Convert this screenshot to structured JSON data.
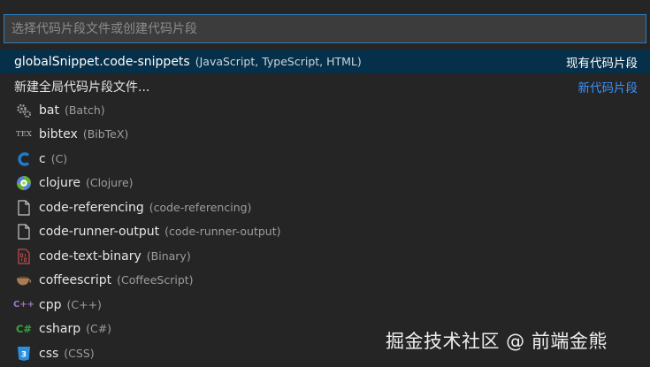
{
  "search": {
    "placeholder": "选择代码片段文件或创建代码片段"
  },
  "global_item": {
    "label": "globalSnippet.code-snippets",
    "description": "(JavaScript, TypeScript, HTML)",
    "group": "现有代码片段"
  },
  "new_item": {
    "label": "新建全局代码片段文件...",
    "group": "新代码片段"
  },
  "languages": [
    {
      "label": "bat",
      "description": "(Batch)",
      "icon": "gear-icon"
    },
    {
      "label": "bibtex",
      "description": "(BibTeX)",
      "icon": "tex-icon"
    },
    {
      "label": "c",
      "description": "(C)",
      "icon": "c-language-icon"
    },
    {
      "label": "clojure",
      "description": "(Clojure)",
      "icon": "clojure-icon"
    },
    {
      "label": "code-referencing",
      "description": "(code-referencing)",
      "icon": "file-icon"
    },
    {
      "label": "code-runner-output",
      "description": "(code-runner-output)",
      "icon": "file-icon"
    },
    {
      "label": "code-text-binary",
      "description": "(Binary)",
      "icon": "binary-file-icon"
    },
    {
      "label": "coffeescript",
      "description": "(CoffeeScript)",
      "icon": "coffee-icon"
    },
    {
      "label": "cpp",
      "description": "(C++)",
      "icon": "cpp-icon"
    },
    {
      "label": "csharp",
      "description": "(C#)",
      "icon": "csharp-icon"
    },
    {
      "label": "css",
      "description": "(CSS)",
      "icon": "css3-icon"
    }
  ],
  "icon_glyphs": {
    "tex": "TEX",
    "cpp": "C++",
    "csharp": "C#",
    "css": "3"
  },
  "watermark": "掘金技术社区 @ 前端金熊",
  "colors": {
    "accent": "#3794ff",
    "selection": "#062f4a",
    "focus_border": "#2f7dbb"
  }
}
